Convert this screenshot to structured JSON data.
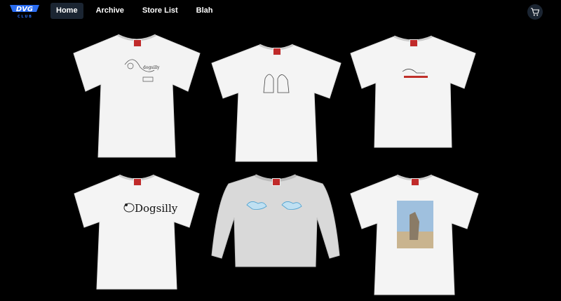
{
  "header": {
    "logo": {
      "icon": "dvg-logo",
      "text": "DVG",
      "subtext": "C L U B"
    },
    "nav": [
      {
        "label": "Home",
        "active": true
      },
      {
        "label": "Archive",
        "active": false
      },
      {
        "label": "Store List",
        "active": false
      },
      {
        "label": "Blah",
        "active": false
      }
    ],
    "cart": {
      "icon": "cart-icon"
    }
  },
  "products": [
    {
      "kind": "tshirt",
      "print": "line-sketch",
      "print_text": "dogsilly"
    },
    {
      "kind": "tshirt",
      "print": "line-sketch"
    },
    {
      "kind": "tshirt",
      "print": "red-logo"
    },
    {
      "kind": "tshirt",
      "print": "dogsilly-wordmark",
      "print_text": "Dogsilly"
    },
    {
      "kind": "sweatshirt",
      "print": "blue-clouds"
    },
    {
      "kind": "tshirt",
      "print": "photo-print"
    }
  ],
  "colors": {
    "accent": "#2a6cf0",
    "nav_active_bg": "#1b2532",
    "background": "#000000"
  }
}
